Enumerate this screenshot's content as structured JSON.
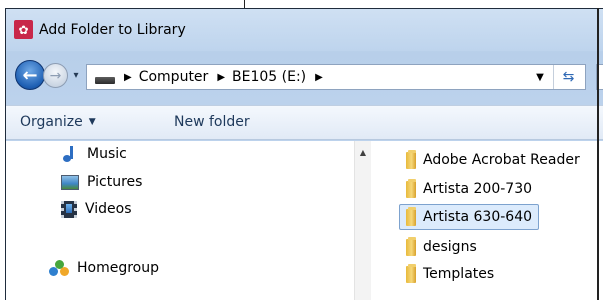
{
  "window": {
    "title": "Add Folder to Library",
    "app_icon": "library-icon"
  },
  "navigation": {
    "back_icon": "back-arrow-icon",
    "forward_icon": "forward-arrow-icon",
    "breadcrumbs": [
      "Computer",
      "BE105 (E:)"
    ],
    "refresh_icon": "refresh-icon"
  },
  "toolbar": {
    "organize_label": "Organize",
    "new_folder_label": "New folder"
  },
  "nav_pane": {
    "items": [
      {
        "label": "Music",
        "icon": "music-icon"
      },
      {
        "label": "Pictures",
        "icon": "pictures-icon"
      },
      {
        "label": "Videos",
        "icon": "videos-icon"
      },
      {
        "label": "Homegroup",
        "icon": "homegroup-icon"
      }
    ]
  },
  "file_list": {
    "items": [
      {
        "label": "Adobe Acrobat Reader",
        "selected": false
      },
      {
        "label": "Artista 200-730",
        "selected": false
      },
      {
        "label": "Artista 630-640",
        "selected": true
      },
      {
        "label": "designs",
        "selected": false
      },
      {
        "label": "Templates",
        "selected": false
      }
    ]
  },
  "colors": {
    "selection_bg": "#dcebfc",
    "selection_border": "#7da2ce",
    "toolbar_text": "#1e395b",
    "window_frame": "#bcd2ec"
  }
}
